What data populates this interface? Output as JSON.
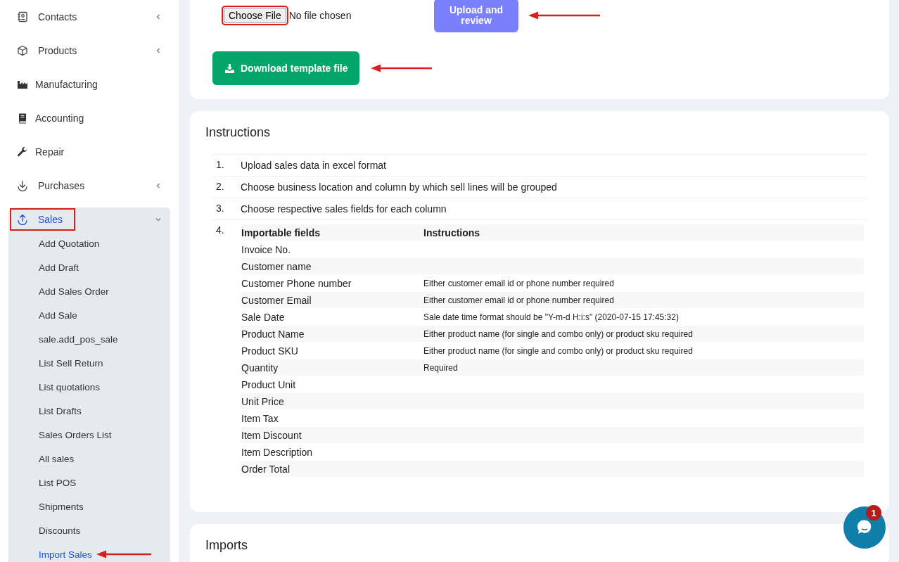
{
  "sidebar": {
    "items": [
      {
        "label": "Contacts",
        "kind": "contacts",
        "submenu": true,
        "expanded": false,
        "highlighted": false
      },
      {
        "label": "Products",
        "kind": "box",
        "submenu": true,
        "expanded": false,
        "highlighted": false
      },
      {
        "label": "Manufacturing",
        "kind": "factory",
        "submenu": false,
        "expanded": false,
        "highlighted": false
      },
      {
        "label": "Accounting",
        "kind": "book",
        "submenu": false,
        "expanded": false,
        "highlighted": false
      },
      {
        "label": "Repair",
        "kind": "wrench",
        "submenu": false,
        "expanded": false,
        "highlighted": false
      },
      {
        "label": "Purchases",
        "kind": "down",
        "submenu": true,
        "expanded": false,
        "highlighted": false
      },
      {
        "label": "Sales",
        "kind": "up",
        "submenu": true,
        "expanded": true,
        "highlighted": true,
        "children": [
          {
            "label": "Add Quotation",
            "selected": false
          },
          {
            "label": "Add Draft",
            "selected": false
          },
          {
            "label": "Add Sales Order",
            "selected": false
          },
          {
            "label": "Add Sale",
            "selected": false
          },
          {
            "label": "sale.add_pos_sale",
            "selected": false
          },
          {
            "label": "List Sell Return",
            "selected": false
          },
          {
            "label": "List quotations",
            "selected": false
          },
          {
            "label": "List Drafts",
            "selected": false
          },
          {
            "label": "Sales Orders List",
            "selected": false
          },
          {
            "label": "All sales",
            "selected": false
          },
          {
            "label": "List POS",
            "selected": false
          },
          {
            "label": "Shipments",
            "selected": false
          },
          {
            "label": "Discounts",
            "selected": false
          },
          {
            "label": "Import Sales",
            "selected": true
          }
        ]
      }
    ]
  },
  "upload": {
    "choose_button": "Choose File",
    "file_status": "No file chosen",
    "upload_button": "Upload and review",
    "download_button": "Download template file"
  },
  "instructions": {
    "title": "Instructions",
    "steps": [
      {
        "number": "1.",
        "text": "Upload sales data in excel format"
      },
      {
        "number": "2.",
        "text": "Choose business location and column by which sell lines will be grouped"
      },
      {
        "number": "3.",
        "text": "Choose respective sales fields for each column"
      },
      {
        "number": "4.",
        "table": {
          "columns": [
            "Importable fields",
            "Instructions"
          ],
          "rows": [
            [
              "Invoice No.",
              ""
            ],
            [
              "Customer name",
              ""
            ],
            [
              "Customer Phone number",
              "Either customer email id or phone number required"
            ],
            [
              "Customer Email",
              "Either customer email id or phone number required"
            ],
            [
              "Sale Date",
              "Sale date time format should be \"Y-m-d H:i:s\" (2020-07-15 17:45:32)"
            ],
            [
              "Product Name",
              "Either product name (for single and combo only) or product sku required"
            ],
            [
              "Product SKU",
              "Either product name (for single and combo only) or product sku required"
            ],
            [
              "Quantity",
              "Required"
            ],
            [
              "Product Unit",
              ""
            ],
            [
              "Unit Price",
              ""
            ],
            [
              "Item Tax",
              ""
            ],
            [
              "Item Discount",
              ""
            ],
            [
              "Item Description",
              ""
            ],
            [
              "Order Total",
              ""
            ]
          ]
        }
      }
    ]
  },
  "imports": {
    "title": "Imports"
  },
  "chat": {
    "badge": "1"
  }
}
